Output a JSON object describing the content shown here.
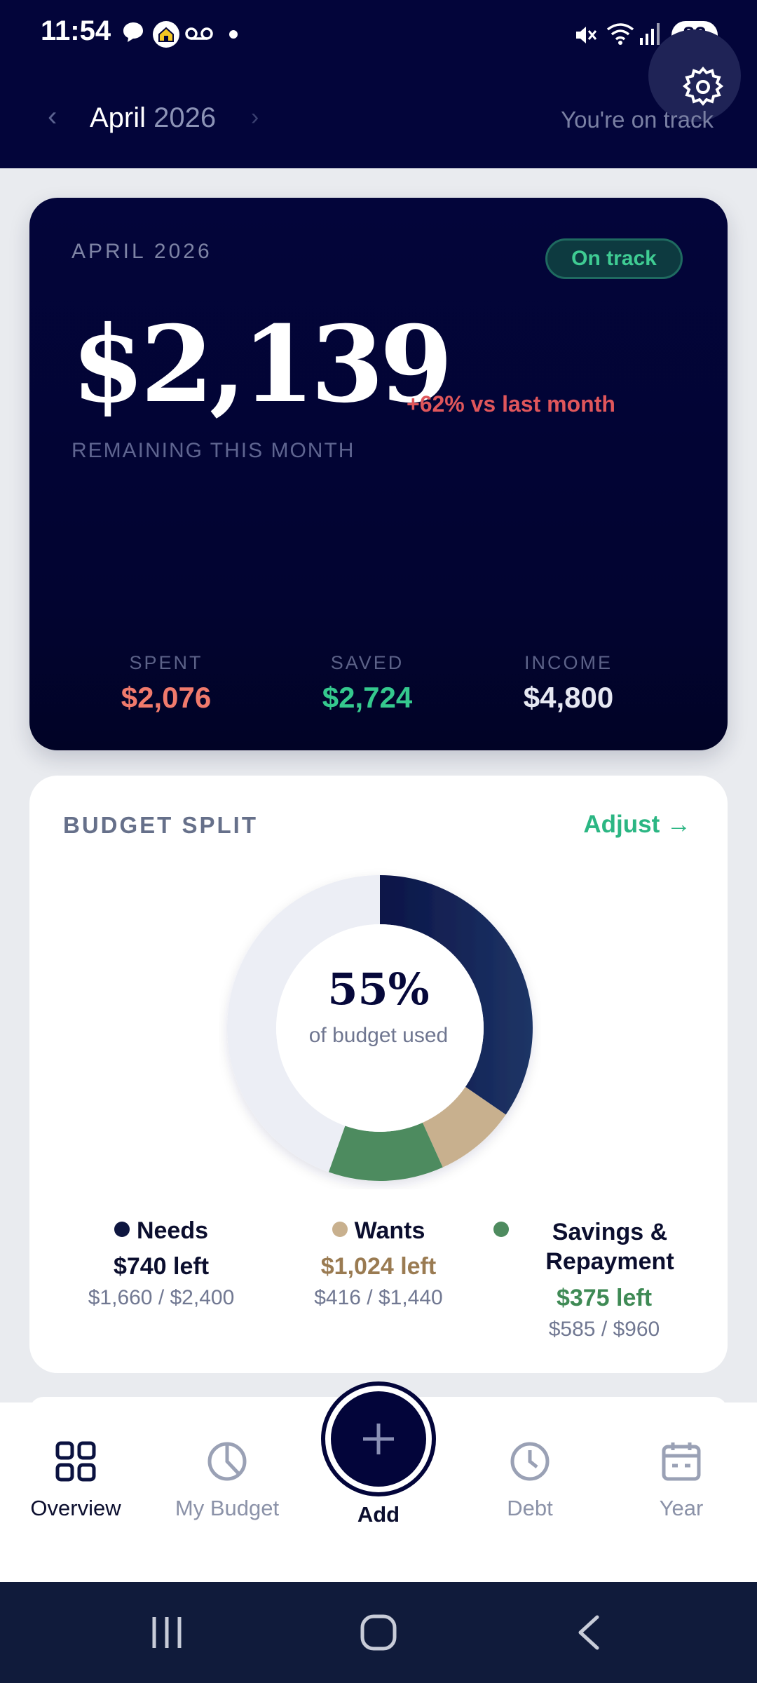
{
  "status_bar": {
    "time": "11:54",
    "battery": "83",
    "left_icons": [
      "chat-bubble-icon",
      "home-app-icon",
      "voicemail-icon",
      "dot-icon"
    ],
    "right_icons": [
      "mute-icon",
      "wifi-icon",
      "signal-icon",
      "battery-icon"
    ]
  },
  "header": {
    "month": "April",
    "year": "2026",
    "status": "You're on track",
    "prev_icon": "chevron-left-icon",
    "next_icon": "chevron-right-icon",
    "settings_icon": "gear-icon"
  },
  "hero": {
    "month_label": "APRIL 2026",
    "badge": "On track",
    "amount": "$2,139",
    "delta": "+62% vs last month",
    "remaining_label": "REMAINING THIS MONTH",
    "stats": [
      {
        "label": "SPENT",
        "value": "$2,076",
        "color": "#f07a6c"
      },
      {
        "label": "SAVED",
        "value": "$2,724",
        "color": "#35c98e"
      },
      {
        "label": "INCOME",
        "value": "$4,800",
        "color": "#e6e8f2"
      }
    ]
  },
  "budget_split": {
    "title": "BUDGET SPLIT",
    "adjust": "Adjust →",
    "percent_used": "55%",
    "percent_sub": "of budget used",
    "categories": [
      {
        "name": "Needs",
        "left": "$740 left",
        "detail": "$1,660 / $2,400",
        "color": "#0e1640",
        "left_color": "#0b0e2e",
        "spent": 1660
      },
      {
        "name": "Wants",
        "left": "$1,024 left",
        "detail": "$416 / $1,440",
        "color": "#c8b08e",
        "left_color": "#9a7b52",
        "spent": 416
      },
      {
        "name": "Savings & Repayment",
        "left": "$375 left",
        "detail": "$585 / $960",
        "color": "#4e8b5f",
        "left_color": "#3f8a55",
        "spent": 585
      }
    ],
    "total_budget": 4800
  },
  "bottom_nav": {
    "items": [
      {
        "label": "Overview",
        "icon": "grid-icon",
        "active": true
      },
      {
        "label": "My Budget",
        "icon": "pie-chart-icon",
        "active": false
      },
      {
        "label": "Add",
        "icon": "plus-icon",
        "active": false
      },
      {
        "label": "Debt",
        "icon": "clock-icon",
        "active": false
      },
      {
        "label": "Year",
        "icon": "calendar-icon",
        "active": false
      }
    ]
  },
  "system_nav": {
    "icons": [
      "recent-apps-icon",
      "home-icon",
      "back-icon"
    ]
  }
}
